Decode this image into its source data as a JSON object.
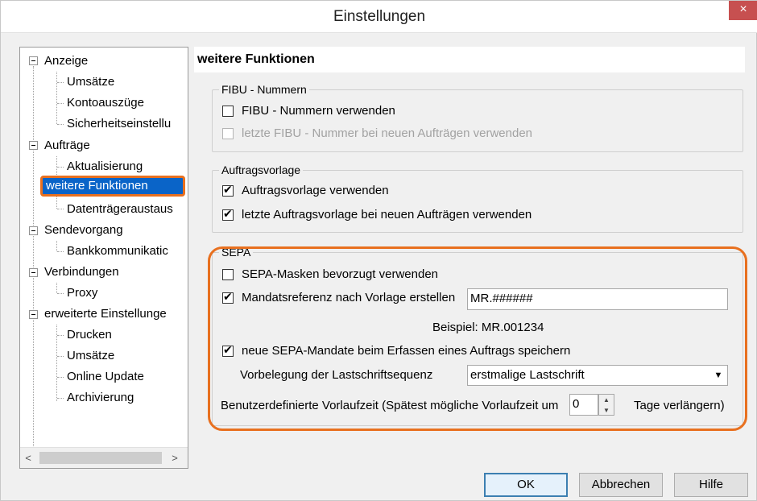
{
  "window": {
    "title": "Einstellungen",
    "close": "×"
  },
  "tree": {
    "items": [
      "Anzeige",
      "Umsätze",
      "Kontoauszüge",
      "Sicherheitseinstellu",
      "Aufträge",
      "Aktualisierung",
      "weitere Funktionen",
      "Datenträgeraustaus",
      "Sendevorgang",
      "Bankkommunikatic",
      "Verbindungen",
      "Proxy",
      "erweiterte Einstellunge",
      "Drucken",
      "Umsätze",
      "Online Update",
      "Archivierung"
    ],
    "selected": "weitere Funktionen"
  },
  "scrollbar": {
    "left_arrow": "<",
    "right_arrow": ">"
  },
  "section": {
    "title": "weitere Funktionen"
  },
  "fibu": {
    "legend": "FIBU - Nummern",
    "use_label": "FIBU - Nummern verwenden",
    "use_checked": false,
    "last_label": "letzte FIBU - Nummer bei neuen Aufträgen verwenden",
    "last_checked": false
  },
  "vorlage": {
    "legend": "Auftragsvorlage",
    "use_label": "Auftragsvorlage verwenden",
    "use_checked": true,
    "last_label": "letzte Auftragsvorlage bei neuen Aufträgen verwenden",
    "last_checked": true
  },
  "sepa": {
    "legend": "SEPA",
    "masks_label": "SEPA-Masken bevorzugt verwenden",
    "masks_checked": false,
    "mandate_label": "Mandatsreferenz nach Vorlage erstellen",
    "mandate_checked": true,
    "mandate_value": "MR.######",
    "example": "Beispiel: MR.001234",
    "save_label": "neue SEPA-Mandate beim Erfassen eines Auftrags speichern",
    "save_checked": true,
    "sequence_label": "Vorbelegung der Lastschriftsequenz",
    "sequence_value": "erstmalige Lastschrift",
    "leadtime_label": "Benutzerdefinierte Vorlaufzeit (Spätest mögliche Vorlaufzeit um",
    "leadtime_value": "0",
    "leadtime_suffix": "Tage verlängern)"
  },
  "buttons": {
    "ok": "OK",
    "cancel": "Abbrechen",
    "help": "Hilfe"
  },
  "colors": {
    "highlight": "#e8701f",
    "selection": "#0a64c8"
  }
}
